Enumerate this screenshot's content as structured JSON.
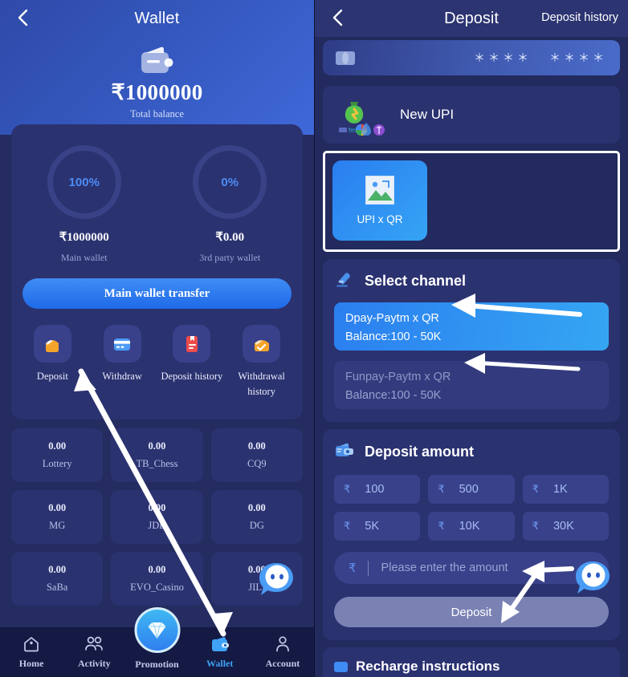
{
  "left": {
    "header": {
      "back_icon": "chevron-left-icon",
      "title": "Wallet",
      "wallet_icon": "wallet-icon",
      "balance": "₹1000000",
      "balance_label": "Total balance"
    },
    "wallet_card": {
      "rings": [
        {
          "pct": "100%",
          "amount": "₹1000000",
          "label": "Main wallet"
        },
        {
          "pct": "0%",
          "amount": "₹0.00",
          "label": "3rd party wallet"
        }
      ],
      "transfer_label": "Main wallet transfer",
      "actions": [
        {
          "label": "Deposit",
          "icon": "deposit-bag-icon"
        },
        {
          "label": "Withdraw",
          "icon": "card-icon"
        },
        {
          "label": "Deposit history",
          "icon": "deposit-history-icon"
        },
        {
          "label": "Withdrawal history",
          "icon": "withdrawal-history-icon"
        }
      ]
    },
    "games": [
      {
        "amount": "0.00",
        "name": "Lottery"
      },
      {
        "amount": "0.00",
        "name": "TB_Chess"
      },
      {
        "amount": "0.00",
        "name": "CQ9"
      },
      {
        "amount": "0.00",
        "name": "MG"
      },
      {
        "amount": "0.00",
        "name": "JDB"
      },
      {
        "amount": "0.00",
        "name": "DG"
      },
      {
        "amount": "0.00",
        "name": "SaBa"
      },
      {
        "amount": "0.00",
        "name": "EVO_Casino"
      },
      {
        "amount": "0.00",
        "name": "JILI"
      }
    ],
    "nav": [
      {
        "label": "Home",
        "icon": "home-icon",
        "active": false
      },
      {
        "label": "Activity",
        "icon": "activity-icon",
        "active": false
      },
      {
        "label": "Promotion",
        "icon": "diamond-icon",
        "active": false
      },
      {
        "label": "Wallet",
        "icon": "wallet-nav-icon",
        "active": true
      },
      {
        "label": "Account",
        "icon": "account-icon",
        "active": false
      }
    ]
  },
  "right": {
    "header": {
      "back_icon": "chevron-left-icon",
      "title": "Deposit",
      "history_label": "Deposit history"
    },
    "bank_card": {
      "chip_icon": "card-chip-icon",
      "masked_1": "＊＊＊＊",
      "masked_2": "＊＊＊＊"
    },
    "upi_card": {
      "icon": "money-bag-icon",
      "label": "New UPI"
    },
    "method": {
      "label": "UPI x QR",
      "thumb_icon": "image-placeholder-icon"
    },
    "select_channel": {
      "icon": "eraser-icon",
      "title": "Select channel",
      "channels": [
        {
          "name": "Dpay-Paytm x QR",
          "balance": "Balance:100 - 50K",
          "selected": true
        },
        {
          "name": "Funpay-Paytm x QR",
          "balance": "Balance:100 - 50K",
          "selected": false
        }
      ]
    },
    "deposit_amount": {
      "icon": "wallet-money-icon",
      "title": "Deposit amount",
      "currency": "₹",
      "presets": [
        "100",
        "500",
        "1K",
        "5K",
        "10K",
        "30K"
      ],
      "input_placeholder": "Please enter the amount",
      "input_value": "",
      "submit_label": "Deposit"
    },
    "recharge": {
      "icon": "note-icon",
      "title": "Recharge instructions"
    }
  },
  "colors": {
    "accent_blue": "#3f8cf5",
    "panel_bg": "#222a5e",
    "card_bg": "#2b3270",
    "hero_blue": "#3457bd",
    "nav_bg": "#141a44",
    "active_nav": "#3fa2f7",
    "muted_text": "#9aa4d4"
  }
}
